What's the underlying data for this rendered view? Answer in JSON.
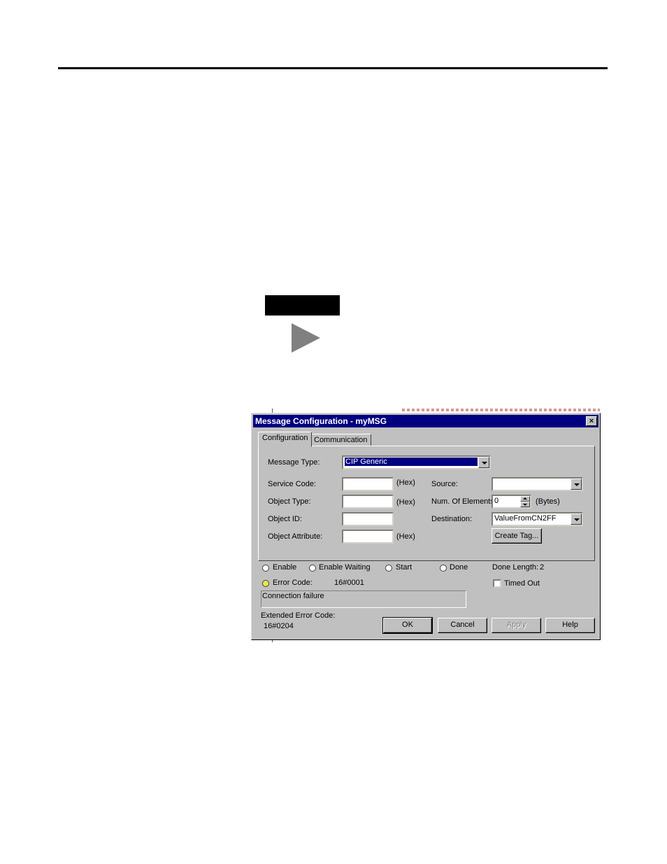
{
  "dialog": {
    "title": "Message Configuration - myMSG",
    "close_glyph": "×",
    "tabs": [
      {
        "label": "Configuration"
      },
      {
        "label": "Communication"
      }
    ],
    "message_type": {
      "label": "Message Type:",
      "value": "CIP Generic"
    },
    "service_code": {
      "label": "Service Code:",
      "value": "",
      "unit": "(Hex)"
    },
    "object_type": {
      "label": "Object Type:",
      "value": "",
      "unit": "(Hex)"
    },
    "object_id": {
      "label": "Object ID:",
      "value": ""
    },
    "object_attribute": {
      "label": "Object Attribute:",
      "value": "",
      "unit": "(Hex)"
    },
    "source": {
      "label": "Source:",
      "value": ""
    },
    "num_elements": {
      "label": "Num. Of Elements:",
      "value": "0",
      "unit": "(Bytes)"
    },
    "destination": {
      "label": "Destination:",
      "value": "ValueFromCN2FF"
    },
    "create_tag_label": "Create Tag...",
    "status": {
      "enable": "Enable",
      "enable_waiting": "Enable Waiting",
      "start": "Start",
      "done": "Done",
      "done_length_label": "Done Length:",
      "done_length_value": "2",
      "error_code_label": "Error Code:",
      "error_code_value": "16#0001",
      "timed_out": "Timed Out",
      "error_message": "Connection failure",
      "extended_error_label": "Extended Error Code:",
      "extended_error_value": "16#0204"
    },
    "buttons": {
      "ok": "OK",
      "cancel": "Cancel",
      "apply": "Apply",
      "help": "Help"
    },
    "indicator_color": "#e8e84a",
    "titlebar_color": "#000080"
  }
}
